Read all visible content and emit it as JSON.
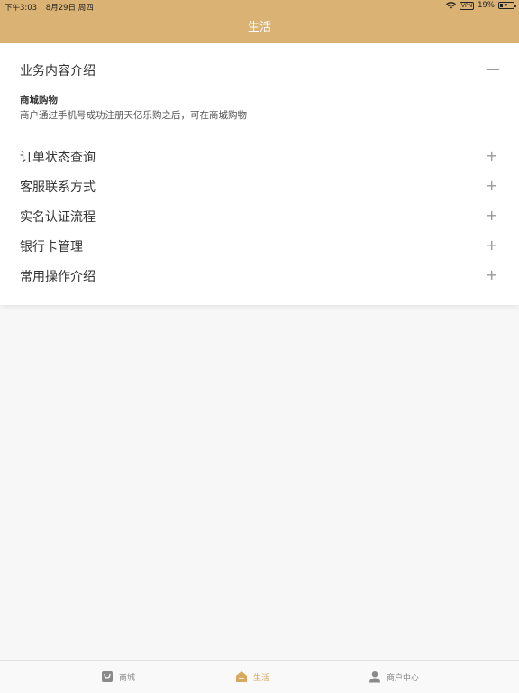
{
  "status_bar": {
    "time": "下午3:03",
    "date": "8月29日 周四",
    "vpn": "VPN",
    "battery_percent": "19%",
    "battery_level": 0.19
  },
  "header": {
    "title": "生活",
    "background_color": "#d9b274"
  },
  "accordion": {
    "items": [
      {
        "title": "业务内容介绍",
        "toggle": "—",
        "expanded": true
      },
      {
        "title": "订单状态查询",
        "toggle": "+",
        "expanded": false
      },
      {
        "title": "客服联系方式",
        "toggle": "+",
        "expanded": false
      },
      {
        "title": "实名认证流程",
        "toggle": "+",
        "expanded": false
      },
      {
        "title": "银行卡管理",
        "toggle": "+",
        "expanded": false
      },
      {
        "title": "常用操作介绍",
        "toggle": "+",
        "expanded": false
      }
    ],
    "expanded_content": {
      "heading": "商城购物",
      "text": "商户通过手机号成功注册天亿乐购之后，可在商城购物"
    }
  },
  "tabbar": {
    "active_color": "#d9a860",
    "tabs": [
      {
        "label": "商城",
        "icon": "shop-icon",
        "active": false
      },
      {
        "label": "生活",
        "icon": "home-icon",
        "active": true
      },
      {
        "label": "商户中心",
        "icon": "user-icon",
        "active": false
      }
    ]
  }
}
